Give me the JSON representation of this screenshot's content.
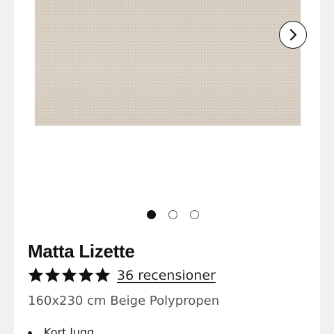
{
  "gallery": {
    "next_icon": "chevron-right-icon",
    "dots": [
      {
        "active": true
      },
      {
        "active": false
      },
      {
        "active": false
      }
    ]
  },
  "product": {
    "title": "Matta Lizette",
    "rating": 5,
    "rating_max": 5,
    "reviews_label": "36 recensioner",
    "subtitle": "160x230 cm Beige Polypropen",
    "features": [
      "Kort lugg"
    ]
  },
  "colors": {
    "rug": "#d8cfc3",
    "star": "#111111",
    "background": "#f1f1f1",
    "card": "#ffffff"
  }
}
